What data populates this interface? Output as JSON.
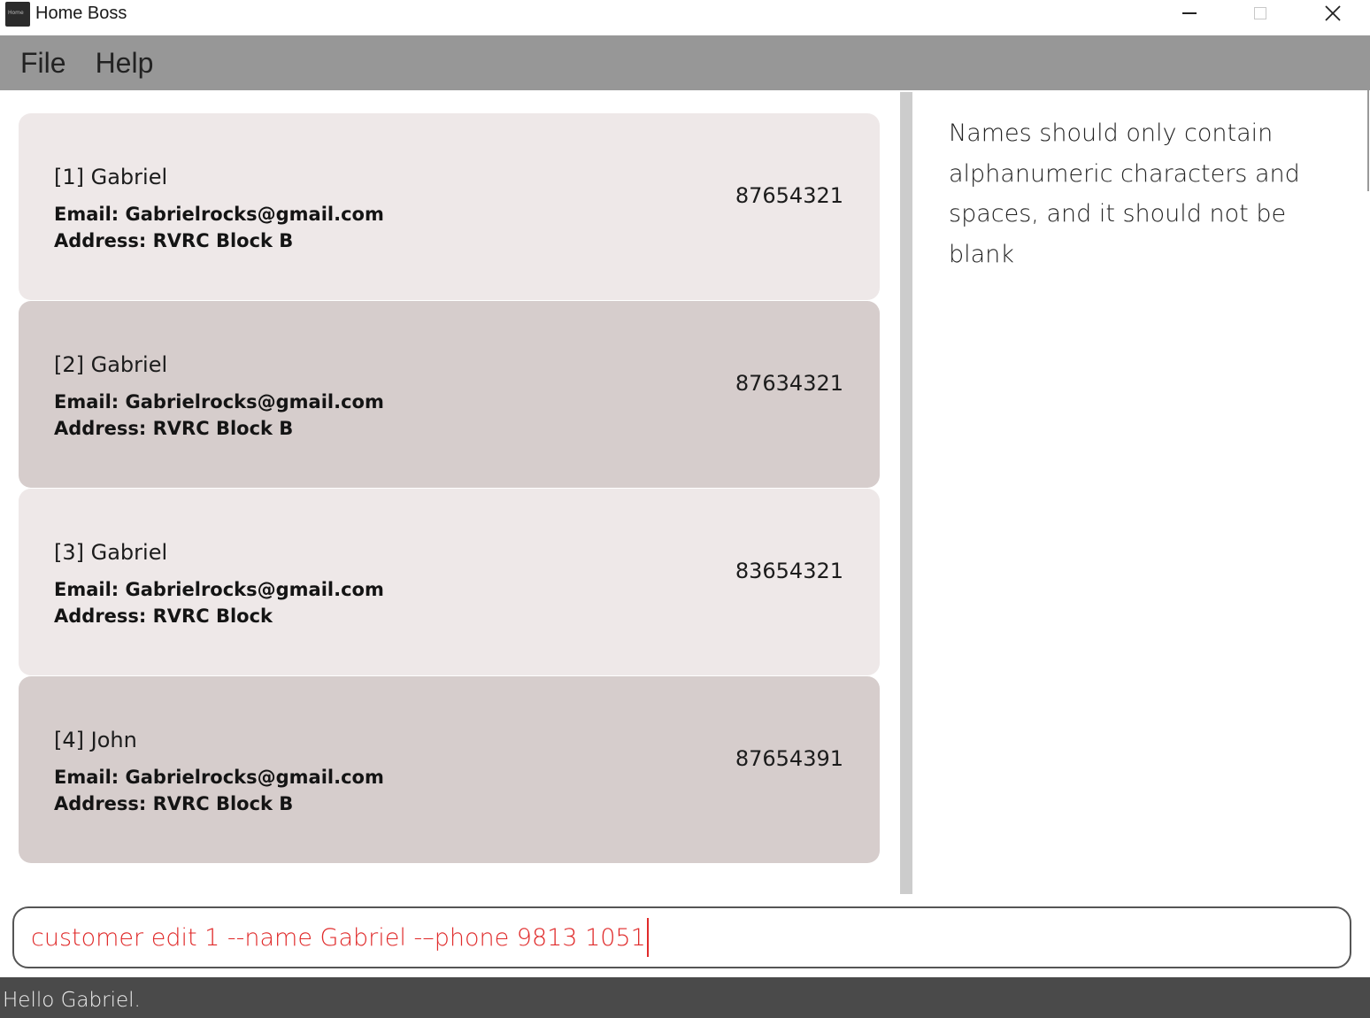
{
  "window": {
    "title": "Home Boss",
    "icon_text": "Home"
  },
  "menu": {
    "items": [
      {
        "label": "File"
      },
      {
        "label": "Help"
      }
    ]
  },
  "customers": [
    {
      "name": "[1] Gabriel",
      "email": "Email: Gabrielrocks@gmail.com",
      "address": "Address: RVRC Block B",
      "phone": "87654321"
    },
    {
      "name": "[2] Gabriel",
      "email": "Email: Gabrielrocks@gmail.com",
      "address": "Address: RVRC Block B",
      "phone": "87634321"
    },
    {
      "name": "[3] Gabriel",
      "email": "Email: Gabrielrocks@gmail.com",
      "address": "Address: RVRC Block",
      "phone": "83654321"
    },
    {
      "name": "[4] John",
      "email": "Email: Gabrielrocks@gmail.com",
      "address": "Address: RVRC Block B",
      "phone": "87654391"
    }
  ],
  "result": {
    "message": "Names should only contain alphanumeric characters and spaces, and it should not be blank"
  },
  "command": {
    "value": "customer edit 1 --name Gabriel -–phone 9813 1051"
  },
  "status": {
    "text": "Hello Gabriel."
  },
  "colors": {
    "menu_bar": "#979797",
    "card_light": "#eee8e8",
    "card_dark": "#d6cdcc",
    "command_error_text": "#e02a2a",
    "status_bar": "#4a4a4a"
  }
}
